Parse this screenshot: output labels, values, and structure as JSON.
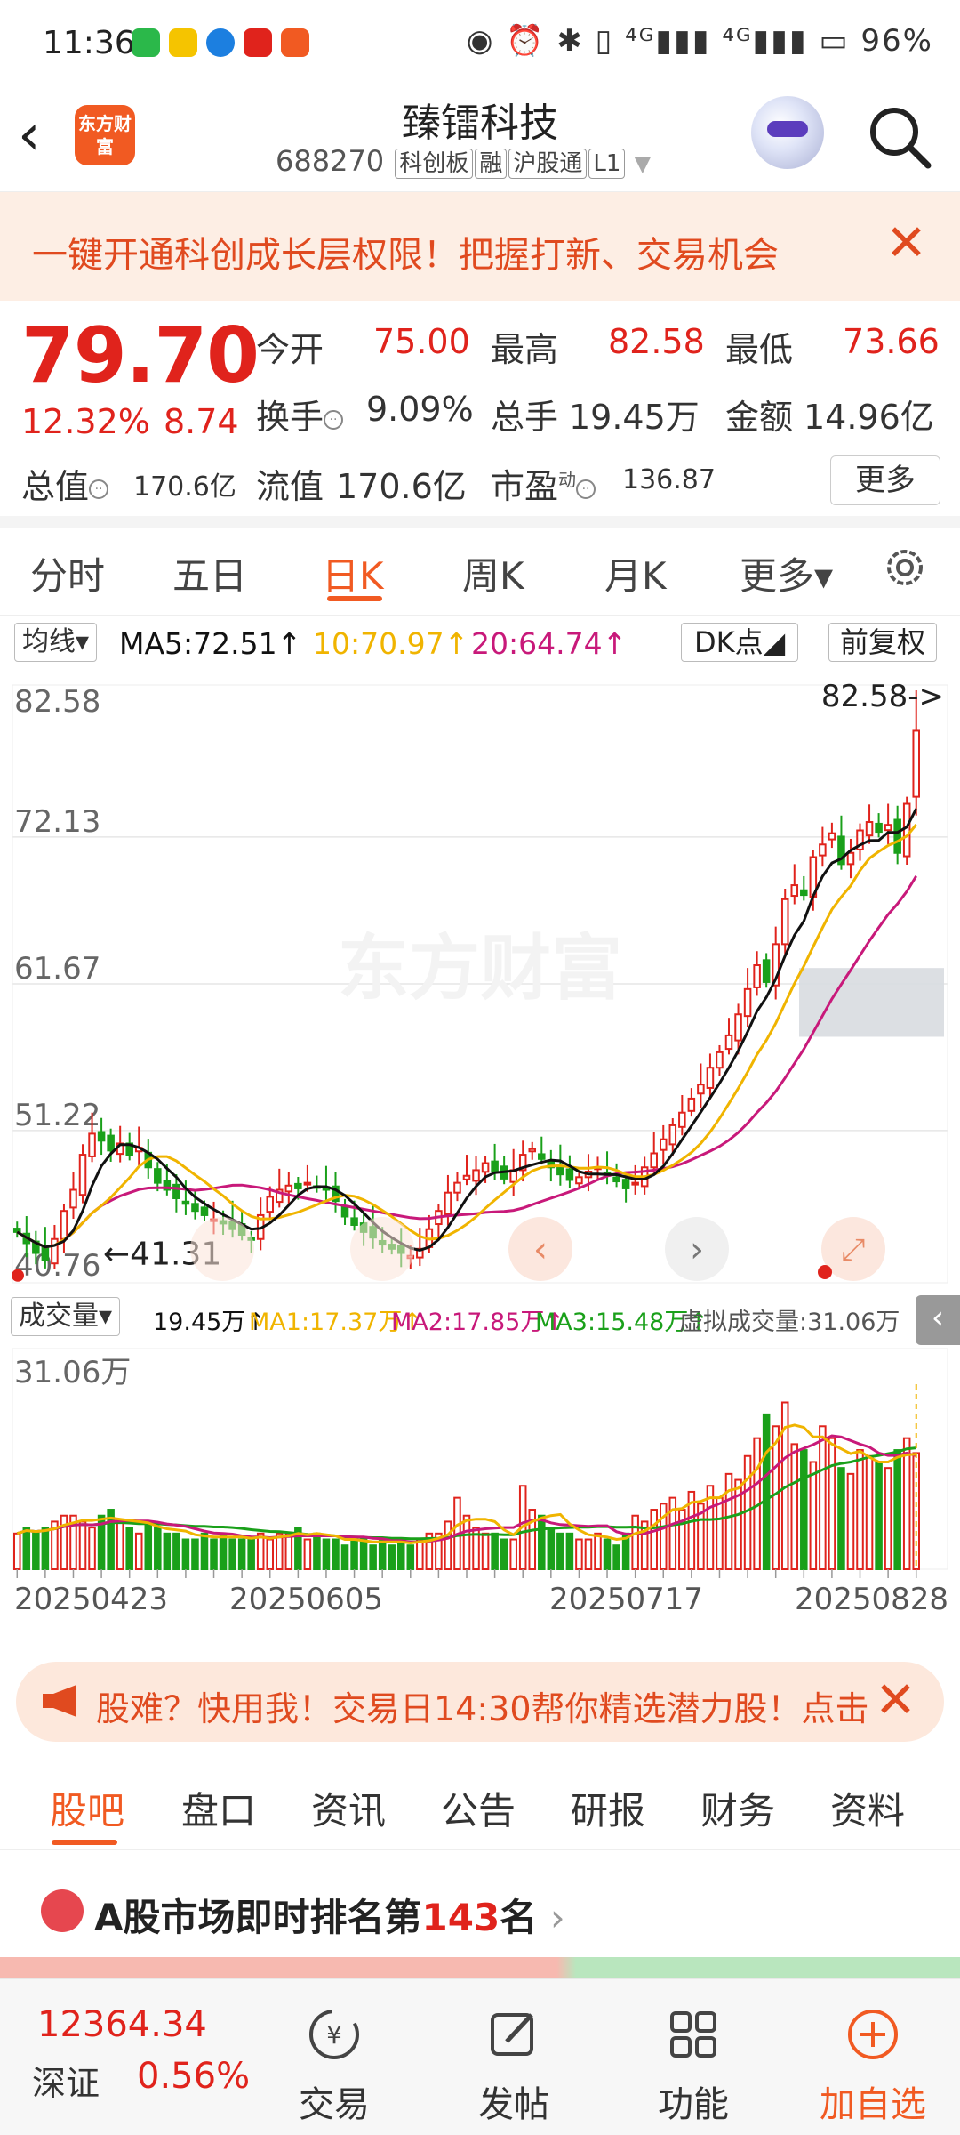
{
  "status_bar": {
    "time": "11:36",
    "right_text": "◉ ⏰ ✱ ▯ ⁴ᴳ▮▮▮ ⁴ᴳ▮▮▮ ▭ 96%",
    "battery": "96%"
  },
  "header": {
    "title": "臻镭科技",
    "code": "688270",
    "tags": [
      "科创板",
      "融",
      "沪股通",
      "L1"
    ],
    "logo_text": "东方财富"
  },
  "banner": {
    "text": "一键开通科创成长层权限！把握打新、交易机会",
    "close": "✕"
  },
  "quote": {
    "price": "79.70",
    "change_pct": "12.32%",
    "change_val": "8.74",
    "open_label": "今开",
    "open": "75.00",
    "high_label": "最高",
    "high": "82.58",
    "low_label": "最低",
    "low": "73.66",
    "turnover_label": "换手",
    "turnover": "9.09%",
    "volume_label": "总手",
    "volume": "19.45万",
    "amount_label": "金额",
    "amount": "14.96亿",
    "mktcap_label": "总值",
    "mktcap": "170.6亿",
    "float_label": "流值",
    "float": "170.6亿",
    "pe_label": "市盈",
    "pe_sup": "动",
    "pe": "136.87",
    "more": "更多"
  },
  "chart_tabs": {
    "items": [
      "分时",
      "五日",
      "日K",
      "周K",
      "月K",
      "更多▾"
    ],
    "active": "日K"
  },
  "ma_legend": {
    "selector": "均线▾",
    "ma5": "MA5:72.51↑",
    "ma10": "10:70.97↑",
    "ma20": "20:64.74↑",
    "dk": "DK点◢",
    "adjust": "前复权"
  },
  "colors": {
    "up": "#e0231c",
    "down": "#1aa01a",
    "ma5": "#111111",
    "ma10": "#f0b400",
    "ma20": "#c8197a",
    "accent": "#f15a22"
  },
  "chart_data": {
    "type": "candlestick",
    "y_ticks": [
      "82.58",
      "72.13",
      "61.67",
      "51.22",
      "40.76"
    ],
    "ylim": [
      40.76,
      82.58
    ],
    "max_marker": "82.58->",
    "min_marker": "41.31",
    "x_ticks": [
      "20250423",
      "20250605",
      "20250717",
      "20250828"
    ],
    "closes": [
      44.0,
      43.2,
      42.5,
      42.0,
      43.5,
      45.5,
      47.0,
      49.5,
      51.0,
      50.5,
      49.8,
      50.3,
      49.5,
      50.0,
      48.6,
      47.5,
      47.0,
      46.4,
      46.0,
      45.5,
      45.2,
      44.9,
      44.6,
      44.2,
      43.8,
      43.5,
      45.2,
      46.5,
      47.0,
      47.3,
      47.1,
      47.5,
      47.2,
      47.0,
      46.2,
      45.1,
      44.5,
      44.0,
      43.6,
      43.1,
      42.8,
      42.5,
      42.3,
      42.8,
      44.2,
      45.5,
      46.8,
      47.5,
      48.0,
      48.4,
      48.9,
      48.3,
      47.8,
      48.4,
      49.5,
      49.9,
      49.2,
      48.6,
      48.1,
      47.7,
      47.9,
      48.3,
      48.6,
      48.0,
      47.6,
      47.1,
      47.5,
      48.6,
      49.6,
      50.6,
      51.6,
      52.5,
      53.5,
      54.5,
      55.7,
      56.8,
      58.0,
      59.5,
      61.3,
      63.0,
      61.8,
      64.5,
      67.7,
      68.7,
      68.0,
      70.7,
      71.6,
      72.4,
      70.2,
      71.0,
      72.6,
      73.2,
      72.5,
      73.0,
      71.0,
      74.5,
      79.7
    ],
    "ma5_last": 72.51,
    "ma10_last": 70.97,
    "ma20_last": 64.74
  },
  "volume_legend": {
    "selector": "成交量▾",
    "vol": "19.45万↑",
    "ma1": "MA1:17.37万↑",
    "ma2": "MA2:17.85万↑",
    "ma3": "MA3:15.48万↑",
    "virtual": "虚拟成交量:31.06万",
    "collapse": "‹"
  },
  "volume_data": {
    "y_top": "31.06万",
    "values": [
      6,
      7,
      6,
      7,
      8,
      9,
      9,
      8,
      7,
      9,
      10,
      8,
      7,
      6,
      8,
      7,
      6,
      6,
      5,
      5,
      6,
      5,
      6,
      5,
      5,
      5,
      6,
      5,
      6,
      6,
      7,
      5,
      6,
      5,
      5,
      4,
      5,
      5,
      4,
      5,
      4,
      5,
      4,
      5,
      6,
      6,
      8,
      12,
      9,
      7,
      6,
      6,
      5,
      5,
      14,
      10,
      9,
      7,
      6,
      6,
      5,
      5,
      6,
      5,
      4,
      6,
      9,
      8,
      10,
      11,
      12,
      10,
      13,
      11,
      14,
      12,
      16,
      15,
      19,
      22,
      26,
      24,
      28,
      21,
      20,
      18,
      24,
      22,
      17,
      16,
      20,
      19,
      18,
      17,
      20,
      22,
      19.5
    ]
  },
  "promo": {
    "text": "股难？快用我！交易日14:30帮你精选潜力股！点击",
    "close": "✕"
  },
  "section_tabs": {
    "items": [
      "股吧",
      "盘口",
      "资讯",
      "公告",
      "研报",
      "财务",
      "资料"
    ],
    "active": "股吧"
  },
  "rank": {
    "prefix": "A股市场即时排名第",
    "number": "143",
    "suffix": "名",
    "arrow": "›"
  },
  "bottom_nav": {
    "index_value": "12364.34",
    "index_name": "深证",
    "index_pct": "0.56%",
    "items": [
      "交易",
      "发帖",
      "功能",
      "加自选"
    ]
  }
}
